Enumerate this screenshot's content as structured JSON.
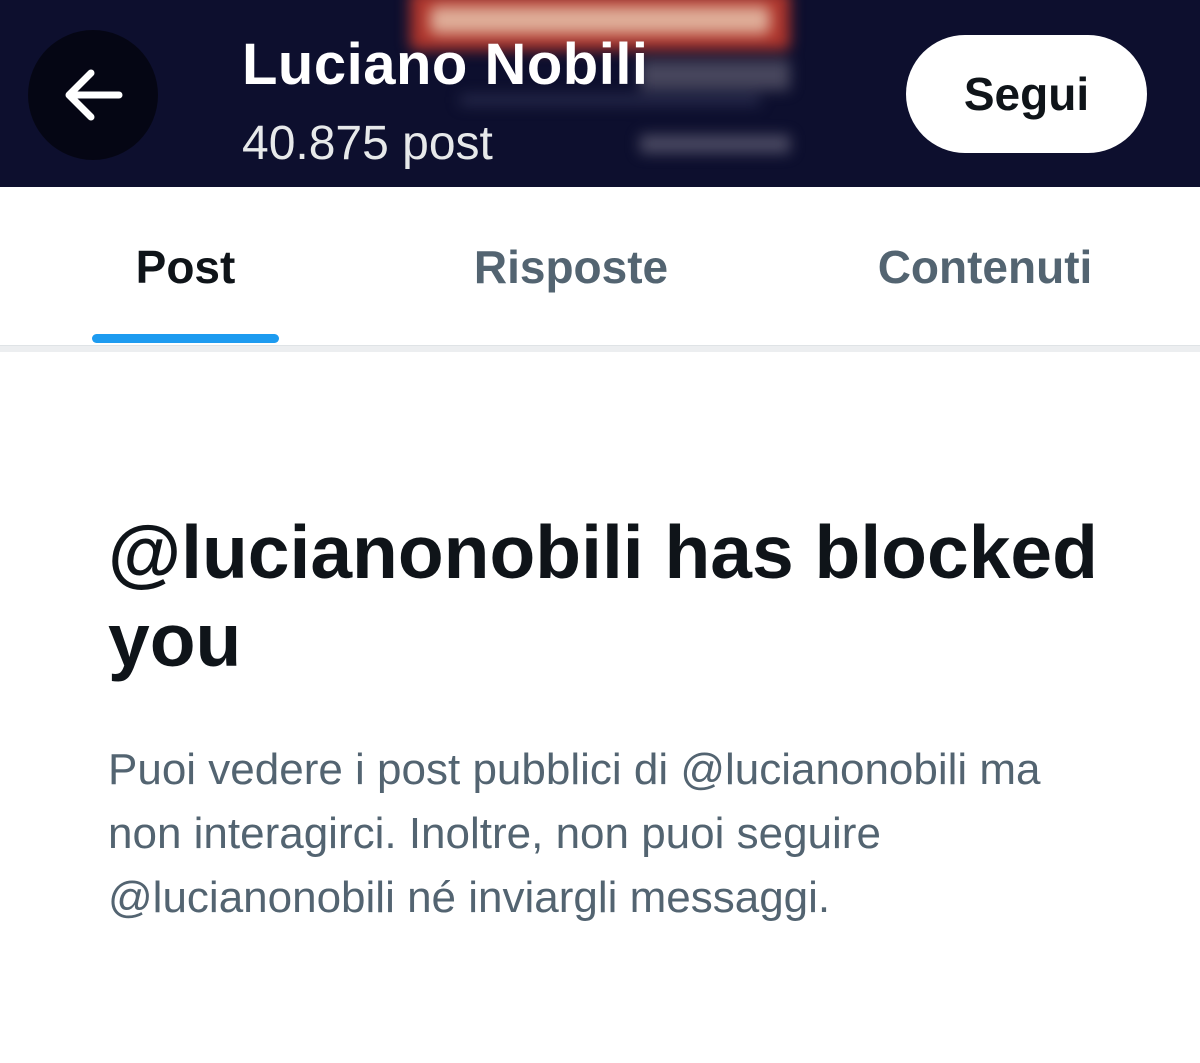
{
  "header": {
    "back_icon": "arrow-left-icon",
    "profile_name": "Luciano Nobili",
    "post_count": "40.875 post",
    "follow_label": "Segui",
    "background_color": "#0d0f2e"
  },
  "tabs": [
    {
      "label": "Post",
      "active": true
    },
    {
      "label": "Risposte",
      "active": false
    },
    {
      "label": "Contenuti",
      "active": false
    }
  ],
  "accent_color": "#1d9bf0",
  "blocked": {
    "title": "@lucianonobili has blocked you",
    "description": "Puoi vedere i post pubblici di @lucianonobili ma non interagirci. Inoltre, non puoi seguire @lucianonobili né inviargli messaggi."
  }
}
